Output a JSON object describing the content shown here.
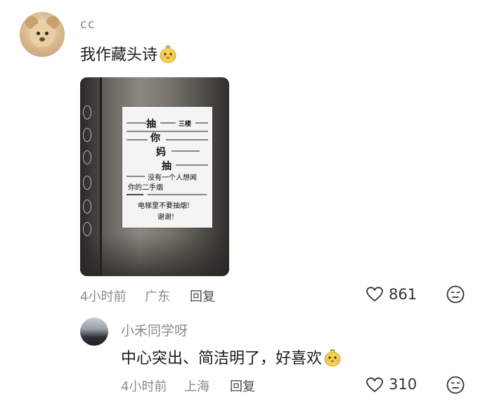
{
  "comment": {
    "username": "cc",
    "text": "我作藏头诗",
    "emoji": "bee-face-emoji",
    "photo": {
      "notice_big": [
        "抽",
        "你",
        "妈",
        "抽"
      ],
      "notice_floor": "三楼",
      "notice_line1": "没有一个人想闻",
      "notice_line2": "你的二手烟",
      "notice_line3": "电梯里不要抽烟!",
      "notice_line4": "谢谢!"
    },
    "time": "4小时前",
    "location": "广东",
    "reply_label": "回复",
    "likes": "861"
  },
  "sub_comment": {
    "username": "小禾同学呀",
    "text": "中心突出、简洁明了，好喜欢",
    "emoji": "bee-face-emoji",
    "time": "4小时前",
    "location": "上海",
    "reply_label": "回复",
    "likes": "310"
  },
  "colors": {
    "meta_gray": "#8a8a8a",
    "text_dark": "#1a1a1a",
    "emoji_yellow": "#f5d34a"
  }
}
